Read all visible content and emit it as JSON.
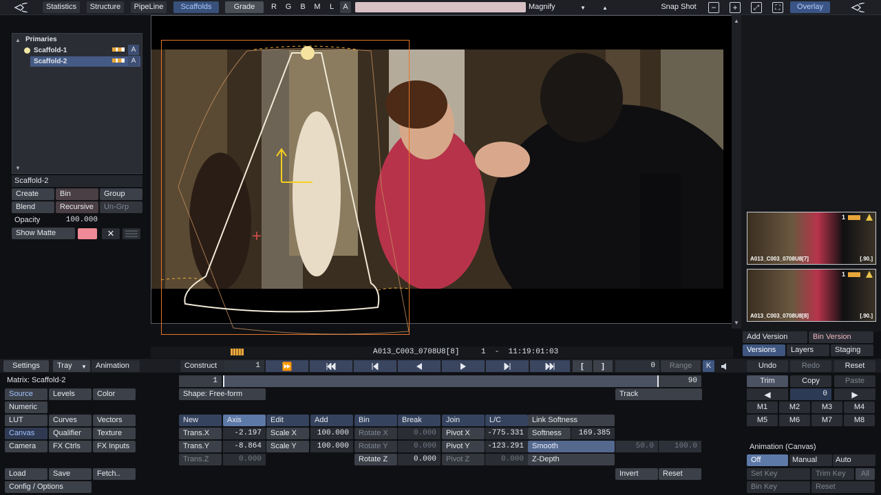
{
  "top_bar": {
    "tabs": [
      "Statistics",
      "Structure",
      "PipeLine",
      "Scaffolds",
      "Grade"
    ],
    "channels": [
      "R",
      "G",
      "B",
      "M",
      "L",
      "A"
    ],
    "magnify": "Magnify",
    "snap_shot": "Snap Shot",
    "overlay": "Overlay"
  },
  "scaffold_panel": {
    "group_title": "Primaries",
    "items": [
      {
        "name": "Scaffold-1",
        "badge": "A"
      },
      {
        "name": "Scaffold-2",
        "badge": "A"
      }
    ],
    "current": "Scaffold-2",
    "buttons": {
      "create": "Create",
      "bin": "Bin",
      "group": "Group",
      "blend": "Blend",
      "recursive": "Recursive",
      "ungroup": "Un-Grp",
      "opacity_label": "Opacity",
      "opacity_value": "100.000",
      "show_matte": "Show Matte"
    }
  },
  "versions": [
    {
      "name": "A013_C003_0708U8[7]",
      "frames": "[.90.]",
      "badge": "1"
    },
    {
      "name": "A013_C003_0708U8[8]",
      "frames": "[.90.]",
      "badge": "1"
    }
  ],
  "timeline": {
    "clip_name": "A013_C003_0708U8[8]",
    "timecode": "1  -  11:19:01:03"
  },
  "right_panel": {
    "add_version": "Add Version",
    "bin_version": "Bin Version",
    "tabs": [
      "Versions",
      "Layers",
      "Staging"
    ],
    "undo": "Undo",
    "redo": "Redo",
    "reset": "Reset",
    "trim": "Trim",
    "copy": "Copy",
    "paste": "Paste",
    "nav_value": "0",
    "memories": [
      "M1",
      "M2",
      "M3",
      "M4",
      "M5",
      "M6",
      "M7",
      "M8"
    ],
    "animation_title": "Animation (Canvas)",
    "anim_modes": [
      "Off",
      "Manual",
      "Auto"
    ],
    "set_key": "Set Key",
    "trim_key": "Trim Key",
    "all": "All",
    "bin_key": "Bin Key",
    "anim_reset": "Reset"
  },
  "controls_bar": {
    "settings": "Settings",
    "tray": "Tray",
    "animation": "Animation",
    "construct": "Construct",
    "construct_value": "1",
    "frame_value": "0",
    "range": "Range",
    "k": "K"
  },
  "matrix": {
    "title": "Matrix: Scaffold-2",
    "menu": [
      [
        "Source",
        "Levels",
        "Color"
      ],
      [
        "Numeric",
        "",
        ""
      ],
      [
        "LUT",
        "Curves",
        "Vectors"
      ],
      [
        "Canvas",
        "Qualifier",
        "Texture"
      ],
      [
        "Camera",
        "FX Ctrls",
        "FX Inputs"
      ]
    ],
    "load": "Load",
    "save": "Save",
    "fetch": "Fetch..",
    "config": "Config / Options"
  },
  "transform": {
    "range_start": "1",
    "range_end": "90",
    "shape": "Shape: Free-form",
    "track": "Track",
    "headers": [
      "New",
      "Axis",
      "Edit",
      "Add",
      "Bin",
      "Break",
      "Join",
      "L/C",
      "Link Softness"
    ],
    "trans_x": {
      "label": "Trans.X",
      "value": "-2.197"
    },
    "trans_y": {
      "label": "Trans.Y",
      "value": "-8.864"
    },
    "trans_z": {
      "label": "Trans.Z",
      "value": "0.000"
    },
    "scale_x": {
      "label": "Scale X",
      "value": "100.000"
    },
    "scale_y": {
      "label": "Scale Y",
      "value": "100.000"
    },
    "rotate_x": {
      "label": "Rotate X",
      "value": "0.000"
    },
    "rotate_y": {
      "label": "Rotate Y",
      "value": "0.000"
    },
    "rotate_z": {
      "label": "Rotate Z",
      "value": "0.000"
    },
    "pivot_x": {
      "label": "Pivot X",
      "value": "-775.331"
    },
    "pivot_y": {
      "label": "Pivot Y",
      "value": "-123.291"
    },
    "pivot_z": {
      "label": "Pivot Z",
      "value": "0.000"
    },
    "softness": {
      "label": "Softness",
      "value": "169.385"
    },
    "smooth": "Smooth",
    "smooth_a": "50.0",
    "smooth_b": "100.0",
    "zdepth": "Z-Depth",
    "invert": "Invert",
    "reset": "Reset"
  },
  "colors": {
    "accent_orange": "#e8762b",
    "selection_blue": "#4a6da8",
    "matte_pink": "#f08a96"
  }
}
